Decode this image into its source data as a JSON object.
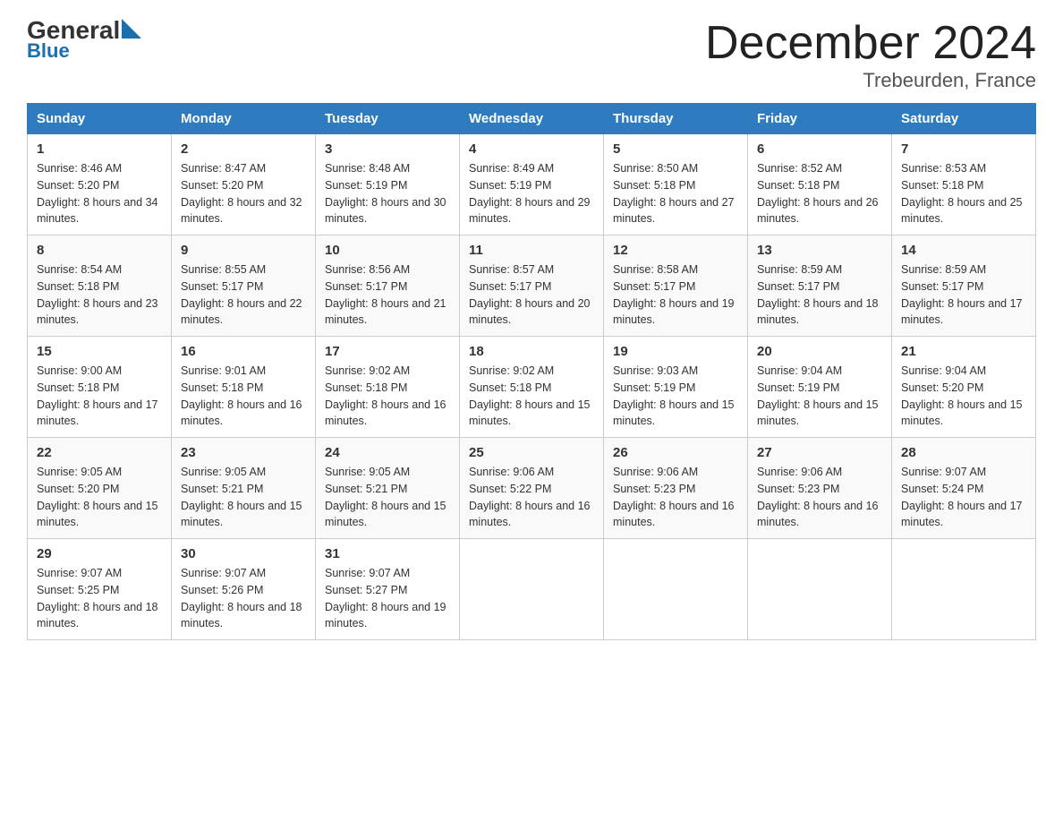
{
  "logo": {
    "general": "General",
    "blue": "Blue",
    "triangle": "▶"
  },
  "title": "December 2024",
  "subtitle": "Trebeurden, France",
  "days_header": [
    "Sunday",
    "Monday",
    "Tuesday",
    "Wednesday",
    "Thursday",
    "Friday",
    "Saturday"
  ],
  "weeks": [
    [
      {
        "day": "1",
        "sunrise": "8:46 AM",
        "sunset": "5:20 PM",
        "daylight": "8 hours and 34 minutes."
      },
      {
        "day": "2",
        "sunrise": "8:47 AM",
        "sunset": "5:20 PM",
        "daylight": "8 hours and 32 minutes."
      },
      {
        "day": "3",
        "sunrise": "8:48 AM",
        "sunset": "5:19 PM",
        "daylight": "8 hours and 30 minutes."
      },
      {
        "day": "4",
        "sunrise": "8:49 AM",
        "sunset": "5:19 PM",
        "daylight": "8 hours and 29 minutes."
      },
      {
        "day": "5",
        "sunrise": "8:50 AM",
        "sunset": "5:18 PM",
        "daylight": "8 hours and 27 minutes."
      },
      {
        "day": "6",
        "sunrise": "8:52 AM",
        "sunset": "5:18 PM",
        "daylight": "8 hours and 26 minutes."
      },
      {
        "day": "7",
        "sunrise": "8:53 AM",
        "sunset": "5:18 PM",
        "daylight": "8 hours and 25 minutes."
      }
    ],
    [
      {
        "day": "8",
        "sunrise": "8:54 AM",
        "sunset": "5:18 PM",
        "daylight": "8 hours and 23 minutes."
      },
      {
        "day": "9",
        "sunrise": "8:55 AM",
        "sunset": "5:17 PM",
        "daylight": "8 hours and 22 minutes."
      },
      {
        "day": "10",
        "sunrise": "8:56 AM",
        "sunset": "5:17 PM",
        "daylight": "8 hours and 21 minutes."
      },
      {
        "day": "11",
        "sunrise": "8:57 AM",
        "sunset": "5:17 PM",
        "daylight": "8 hours and 20 minutes."
      },
      {
        "day": "12",
        "sunrise": "8:58 AM",
        "sunset": "5:17 PM",
        "daylight": "8 hours and 19 minutes."
      },
      {
        "day": "13",
        "sunrise": "8:59 AM",
        "sunset": "5:17 PM",
        "daylight": "8 hours and 18 minutes."
      },
      {
        "day": "14",
        "sunrise": "8:59 AM",
        "sunset": "5:17 PM",
        "daylight": "8 hours and 17 minutes."
      }
    ],
    [
      {
        "day": "15",
        "sunrise": "9:00 AM",
        "sunset": "5:18 PM",
        "daylight": "8 hours and 17 minutes."
      },
      {
        "day": "16",
        "sunrise": "9:01 AM",
        "sunset": "5:18 PM",
        "daylight": "8 hours and 16 minutes."
      },
      {
        "day": "17",
        "sunrise": "9:02 AM",
        "sunset": "5:18 PM",
        "daylight": "8 hours and 16 minutes."
      },
      {
        "day": "18",
        "sunrise": "9:02 AM",
        "sunset": "5:18 PM",
        "daylight": "8 hours and 15 minutes."
      },
      {
        "day": "19",
        "sunrise": "9:03 AM",
        "sunset": "5:19 PM",
        "daylight": "8 hours and 15 minutes."
      },
      {
        "day": "20",
        "sunrise": "9:04 AM",
        "sunset": "5:19 PM",
        "daylight": "8 hours and 15 minutes."
      },
      {
        "day": "21",
        "sunrise": "9:04 AM",
        "sunset": "5:20 PM",
        "daylight": "8 hours and 15 minutes."
      }
    ],
    [
      {
        "day": "22",
        "sunrise": "9:05 AM",
        "sunset": "5:20 PM",
        "daylight": "8 hours and 15 minutes."
      },
      {
        "day": "23",
        "sunrise": "9:05 AM",
        "sunset": "5:21 PM",
        "daylight": "8 hours and 15 minutes."
      },
      {
        "day": "24",
        "sunrise": "9:05 AM",
        "sunset": "5:21 PM",
        "daylight": "8 hours and 15 minutes."
      },
      {
        "day": "25",
        "sunrise": "9:06 AM",
        "sunset": "5:22 PM",
        "daylight": "8 hours and 16 minutes."
      },
      {
        "day": "26",
        "sunrise": "9:06 AM",
        "sunset": "5:23 PM",
        "daylight": "8 hours and 16 minutes."
      },
      {
        "day": "27",
        "sunrise": "9:06 AM",
        "sunset": "5:23 PM",
        "daylight": "8 hours and 16 minutes."
      },
      {
        "day": "28",
        "sunrise": "9:07 AM",
        "sunset": "5:24 PM",
        "daylight": "8 hours and 17 minutes."
      }
    ],
    [
      {
        "day": "29",
        "sunrise": "9:07 AM",
        "sunset": "5:25 PM",
        "daylight": "8 hours and 18 minutes."
      },
      {
        "day": "30",
        "sunrise": "9:07 AM",
        "sunset": "5:26 PM",
        "daylight": "8 hours and 18 minutes."
      },
      {
        "day": "31",
        "sunrise": "9:07 AM",
        "sunset": "5:27 PM",
        "daylight": "8 hours and 19 minutes."
      },
      null,
      null,
      null,
      null
    ]
  ]
}
